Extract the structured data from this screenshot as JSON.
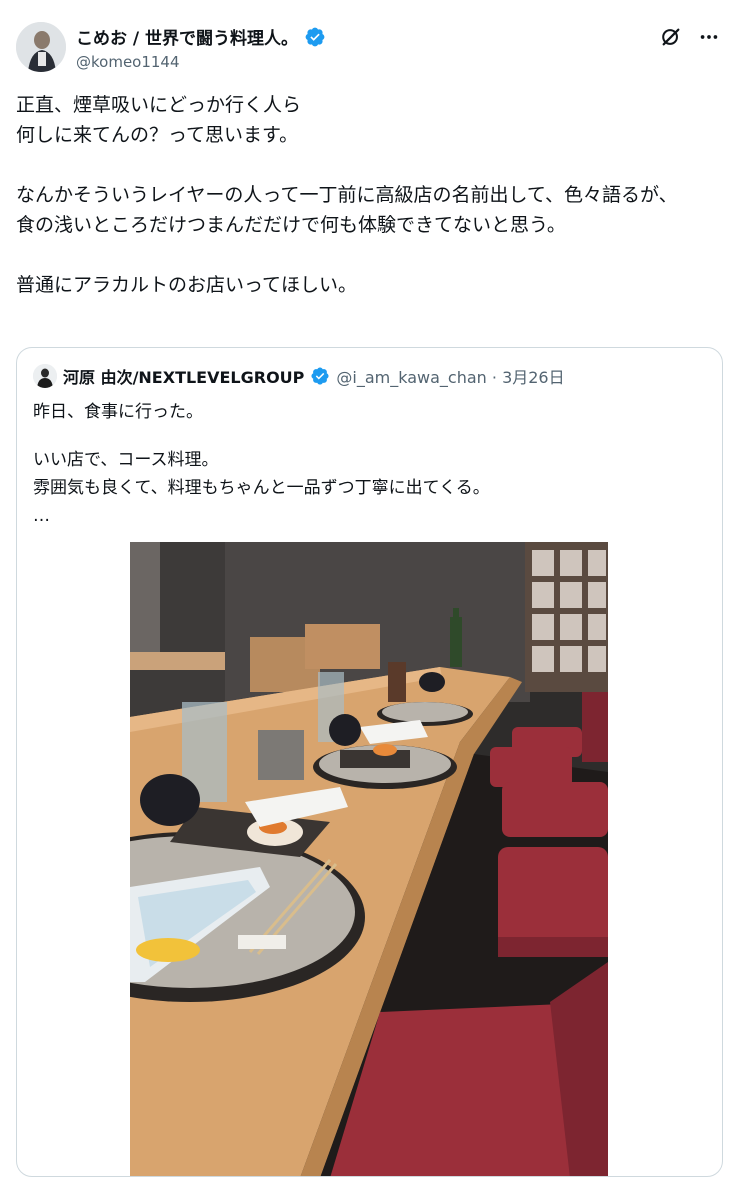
{
  "author": {
    "display_name": "こめお / 世界で闘う料理人。",
    "handle": "@komeo1144"
  },
  "tweet": {
    "lines": [
      "正直、煙草吸いにどっか行く人ら",
      "何しに来てんの？って思います。",
      "",
      "なんかそういうレイヤーの人って一丁前に高級店の名前出して、色々語るが、",
      "食の浅いところだけつまんだだけで何も体験できてないと思う。",
      "",
      "普通にアラカルトのお店いってほしい。"
    ]
  },
  "quoted": {
    "display_name": "河原 由次/NEXTLEVELGROUP",
    "handle_date": "@i_am_kawa_chan · 3月26日",
    "lines": [
      "昨日、食事に行った。",
      "",
      "いい店で、コース料理。",
      "雰囲気も良くて、料理もちゃんと一品ずつ丁寧に出てくる。",
      "…"
    ]
  },
  "icons": {
    "verified": "verified-badge-icon",
    "grok": "grok-icon",
    "more": "more-icon"
  },
  "colors": {
    "verified": "#1d9bf0",
    "text": "#0f1419",
    "secondary": "#536471",
    "border": "#cfd9de"
  }
}
